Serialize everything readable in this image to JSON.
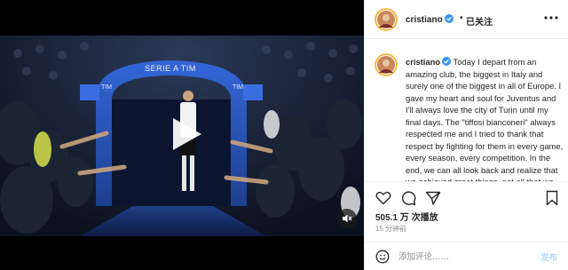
{
  "media": {
    "arch_title": "SERIE A TIM",
    "tim_left": "TIM",
    "tim_right": "TIM",
    "play_icon": "play-icon",
    "mute_icon": "speaker-muted-icon"
  },
  "header": {
    "username": "cristiano",
    "separator": "•",
    "follow_label": "已关注",
    "more_icon": "more-options-icon"
  },
  "caption": {
    "username": "cristiano",
    "text": "Today I depart from an amazing club, the biggest in Italy and surely one of the biggest in all of Europe. I gave my heart and soul for Juventus and I'll always love the city of Turin until my final days. The \"tiffosi bianconeri\" always respected me and I tried to thank that respect by fighting for them in every game, every season, every competition. In the end, we can all look back and realize that we achieved great things, not all that we"
  },
  "actions": {
    "like_icon": "heart-icon",
    "comment_icon": "comment-icon",
    "share_icon": "share-icon",
    "save_icon": "bookmark-icon"
  },
  "stats": {
    "views": "505.1 万 次播放",
    "time_ago": "15 分钟前"
  },
  "comment": {
    "placeholder": "添加评论……",
    "post_label": "发布",
    "emoji_icon": "emoji-icon"
  },
  "colors": {
    "verified": "#3897f0",
    "post_disabled": "#b2dffc",
    "arch_blue": "#2a5bc8"
  }
}
